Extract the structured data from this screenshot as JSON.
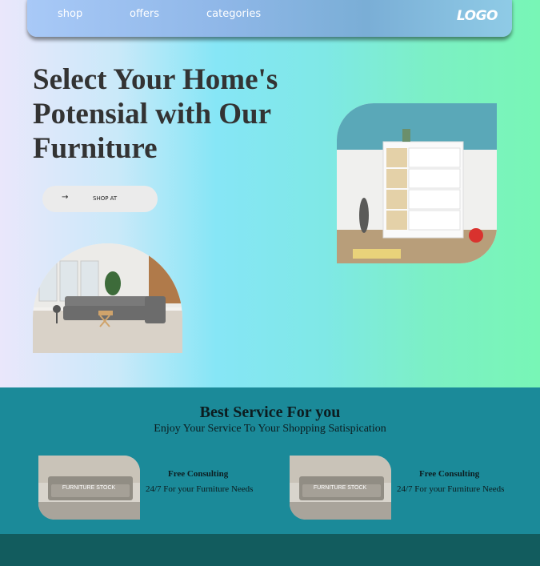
{
  "nav": {
    "links": [
      "shop",
      "offers",
      "categories"
    ],
    "logo": "LOGO"
  },
  "hero": {
    "headline": "Select Your Home's Potensial with Our Furniture",
    "cta_arrow": "→",
    "cta_label": "SHOP AT"
  },
  "services": {
    "title": "Best Service For you",
    "subtitle": "Enjoy Your Service To Your Shopping Satispication",
    "cards": [
      {
        "title": "Free Consulting",
        "text": "24/7 For your Furniture Needs",
        "image_text": "FURNITURE STOCK"
      },
      {
        "title": "Free Consulting",
        "text": "24/7 For your Furniture Needs",
        "image_text": "FURNITURE STOCK"
      }
    ]
  },
  "colors": {
    "services_bg": "#1b8a99",
    "footer_bg": "#125c5e",
    "heading": "#333333"
  }
}
